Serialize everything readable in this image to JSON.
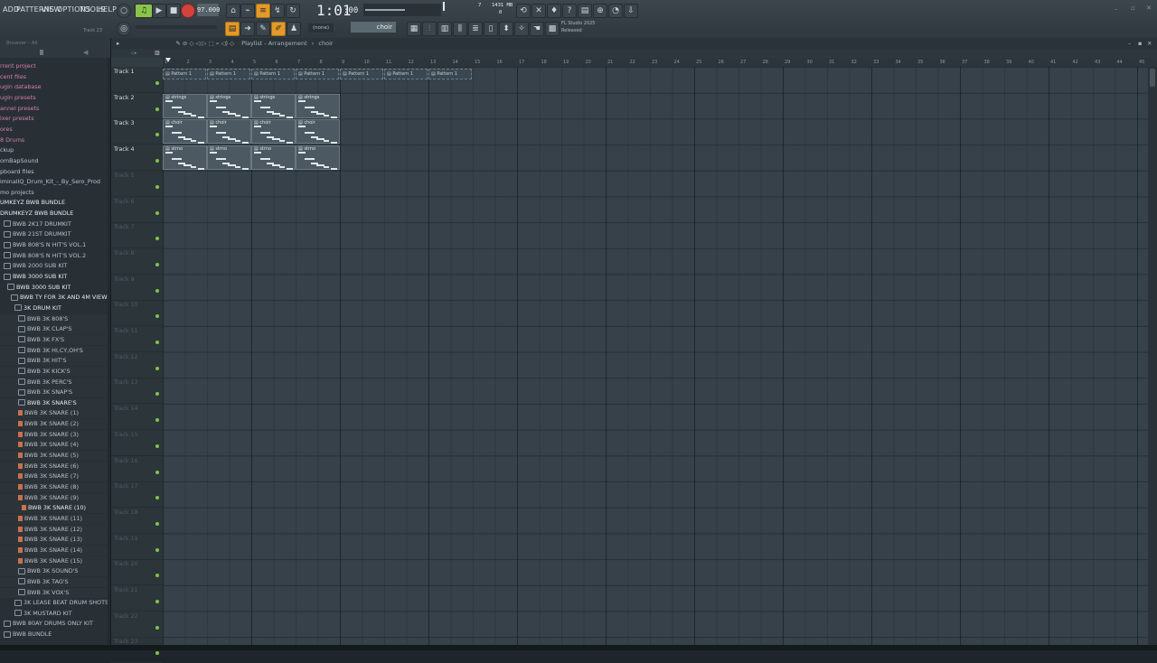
{
  "menu": [
    "ADD",
    "PATTERNS",
    "VIEW",
    "OPTIONS",
    "TOOLS",
    "HELP"
  ],
  "transport": {
    "tempo": "97.000",
    "time": "1:01",
    "time_small": ":00",
    "pattern_label": "(none)",
    "pattern_name": "choir",
    "mem": "1431 MB",
    "mem_small": "0",
    "cpu": "7",
    "hint_title": "FL Studio 2025",
    "hint_sub": "Released",
    "track_hint": "Track 23"
  },
  "browser": {
    "title": "Browser - All",
    "items": [
      {
        "label": "rrent project",
        "indent": 0,
        "style": "pink"
      },
      {
        "label": "cent files",
        "indent": 0,
        "style": "pink"
      },
      {
        "label": "ugin database",
        "indent": 0,
        "style": "pink"
      },
      {
        "label": "ugin presets",
        "indent": 0,
        "style": "pink"
      },
      {
        "label": "annel presets",
        "indent": 0,
        "style": "pink"
      },
      {
        "label": "ixer presets",
        "indent": 0,
        "style": "pink"
      },
      {
        "label": "ores",
        "indent": 0,
        "style": "pink"
      },
      {
        "label": "8 Drums",
        "indent": 0,
        "style": "pink"
      },
      {
        "label": "ckup",
        "indent": 0,
        "style": "normal"
      },
      {
        "label": "omBapSound",
        "indent": 0,
        "style": "normal"
      },
      {
        "label": "pboard files",
        "indent": 0,
        "style": "normal"
      },
      {
        "label": "iminalIQ_Drum_Kit_-_By_Sero_Prod",
        "indent": 0,
        "style": "normal"
      },
      {
        "label": "mo projects",
        "indent": 0,
        "style": "normal"
      },
      {
        "label": "UMKEYZ BWB BUNDLE",
        "indent": 0,
        "style": "bright"
      },
      {
        "label": "DRUMKEYZ BWB BUNDLE",
        "indent": 0,
        "style": "bright"
      },
      {
        "label": "BWB 2K17 DRUMKIT",
        "indent": 1,
        "style": "folder"
      },
      {
        "label": "BWB 21ST DRUMKIT",
        "indent": 1,
        "style": "folder"
      },
      {
        "label": "BWB 808'S N HIT'S VOL.1",
        "indent": 1,
        "style": "folder"
      },
      {
        "label": "BWB 808'S N HIT'S VOL.2",
        "indent": 1,
        "style": "folder"
      },
      {
        "label": "BWB 2000 SUB KIT",
        "indent": 1,
        "style": "folder"
      },
      {
        "label": "BWB 3000 SUB KIT",
        "indent": 1,
        "style": "folder-bright"
      },
      {
        "label": "BWB 3000 SUB KIT",
        "indent": 2,
        "style": "folder-bright"
      },
      {
        "label": "BWB TY FOR 3K AND 4M VIEWS!",
        "indent": 3,
        "style": "folder-bright"
      },
      {
        "label": "3K DRUM KIT",
        "indent": 4,
        "style": "folder-bright"
      },
      {
        "label": "BWB 3K 808'S",
        "indent": 5,
        "style": "folder"
      },
      {
        "label": "BWB 3K CLAP'S",
        "indent": 5,
        "style": "folder"
      },
      {
        "label": "BWB 3K FX'S",
        "indent": 5,
        "style": "folder"
      },
      {
        "label": "BWB 3K HI,CY,OH'S",
        "indent": 5,
        "style": "folder"
      },
      {
        "label": "BWB 3K HIT'S",
        "indent": 5,
        "style": "folder"
      },
      {
        "label": "BWB 3K KICK'S",
        "indent": 5,
        "style": "folder"
      },
      {
        "label": "BWB 3K PERC'S",
        "indent": 5,
        "style": "folder"
      },
      {
        "label": "BWB 3K SNAP'S",
        "indent": 5,
        "style": "folder"
      },
      {
        "label": "BWB 3K SNARE'S",
        "indent": 5,
        "style": "folder-sel"
      },
      {
        "label": "BWB 3K SNARE (1)",
        "indent": 5,
        "style": "file"
      },
      {
        "label": "BWB 3K SNARE (2)",
        "indent": 5,
        "style": "file"
      },
      {
        "label": "BWB 3K SNARE (3)",
        "indent": 5,
        "style": "file"
      },
      {
        "label": "BWB 3K SNARE (4)",
        "indent": 5,
        "style": "file"
      },
      {
        "label": "BWB 3K SNARE (5)",
        "indent": 5,
        "style": "file"
      },
      {
        "label": "BWB 3K SNARE (6)",
        "indent": 5,
        "style": "file"
      },
      {
        "label": "BWB 3K SNARE (7)",
        "indent": 5,
        "style": "file"
      },
      {
        "label": "BWB 3K SNARE (8)",
        "indent": 5,
        "style": "file"
      },
      {
        "label": "BWB 3K SNARE (9)",
        "indent": 5,
        "style": "file"
      },
      {
        "label": "BWB 3K SNARE (10)",
        "indent": 6,
        "style": "file-bright"
      },
      {
        "label": "BWB 3K SNARE (11)",
        "indent": 5,
        "style": "file"
      },
      {
        "label": "BWB 3K SNARE (12)",
        "indent": 5,
        "style": "file"
      },
      {
        "label": "BWB 3K SNARE (13)",
        "indent": 5,
        "style": "file"
      },
      {
        "label": "BWB 3K SNARE (14)",
        "indent": 5,
        "style": "file"
      },
      {
        "label": "BWB 3K SNARE (15)",
        "indent": 5,
        "style": "file"
      },
      {
        "label": "BWB 3K SOUND'S",
        "indent": 5,
        "style": "folder"
      },
      {
        "label": "BWB 3K TAG'S",
        "indent": 5,
        "style": "folder"
      },
      {
        "label": "BWB 3K VOX'S",
        "indent": 5,
        "style": "folder"
      },
      {
        "label": "3K LEASE BEAT DRUM SHOTS",
        "indent": 4,
        "style": "folder"
      },
      {
        "label": "3K MUSTARD KIT",
        "indent": 4,
        "style": "folder"
      },
      {
        "label": "BWB 80AY DRUMS ONLY KIT",
        "indent": 1,
        "style": "folder"
      },
      {
        "label": "BWB BUNDLE",
        "indent": 1,
        "style": "folder"
      }
    ]
  },
  "playlist": {
    "title": "Playlist - Arrangement",
    "pattern": "choir",
    "ruler": [
      "1",
      "2",
      "3",
      "4",
      "5",
      "6",
      "7",
      "8",
      "9",
      "10",
      "11",
      "12",
      "13",
      "14",
      "15",
      "16",
      "17",
      "18",
      "19",
      "20",
      "21",
      "22",
      "23",
      "24",
      "25",
      "26",
      "27",
      "28",
      "29",
      "30",
      "31",
      "32",
      "33",
      "34",
      "35",
      "36",
      "37",
      "38",
      "39",
      "40",
      "41",
      "42",
      "43",
      "44",
      "45"
    ],
    "tracks": [
      "Track 1",
      "Track 2",
      "Track 3",
      "Track 4",
      "Track 5",
      "Track 6",
      "Track 7",
      "Track 8",
      "Track 9",
      "Track 10",
      "Track 11",
      "Track 12",
      "Track 13",
      "Track 14",
      "Track 15",
      "Track 16",
      "Track 17",
      "Track 18",
      "Track 19",
      "Track 20",
      "Track 21",
      "Track 22",
      "Track 23"
    ],
    "pattern_row_label": "Pattern 1",
    "clip_rows": [
      {
        "track": 1,
        "label": "strings"
      },
      {
        "track": 2,
        "label": "choir"
      },
      {
        "track": 3,
        "label": "strno"
      }
    ]
  }
}
